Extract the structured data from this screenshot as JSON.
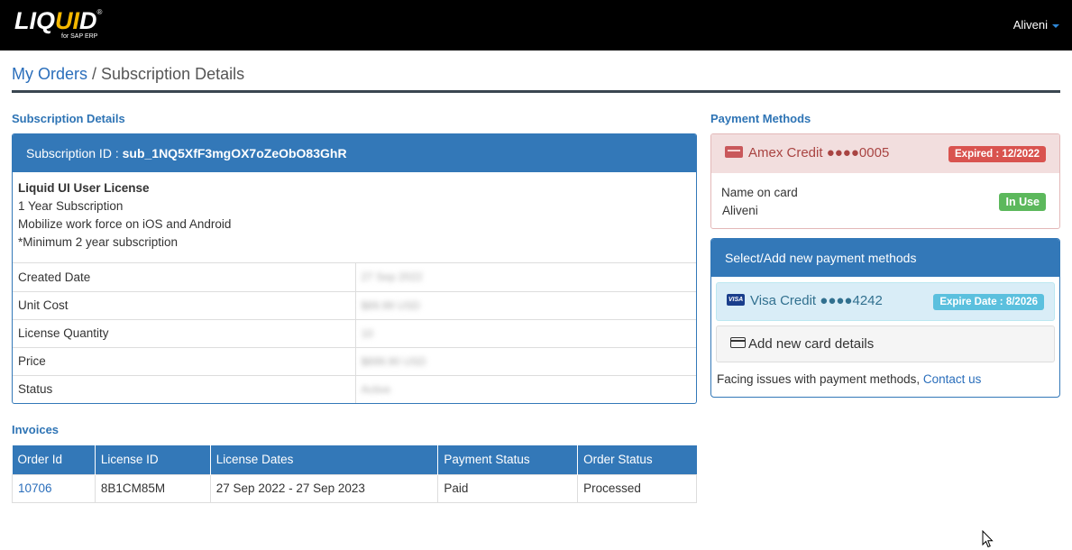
{
  "header": {
    "logo_text_1": "LIQ",
    "logo_text_ui": "UI",
    "logo_text_2": "D",
    "logo_reg": "®",
    "logo_sub": "for SAP ERP",
    "user_name": "Aliveni"
  },
  "breadcrumb": {
    "parent": "My Orders",
    "separator": " / ",
    "current": "Subscription Details"
  },
  "subscription": {
    "section_title": "Subscription Details",
    "id_label": "Subscription ID : ",
    "id_value": "sub_1NQ5XfF3mgOX7oZeObO83GhR",
    "product_name": "Liquid UI User License",
    "line1": "1 Year Subscription",
    "line2": "Mobilize work force on iOS and Android",
    "line3": "*Minimum 2 year subscription",
    "rows": [
      {
        "label": "Created Date",
        "value": "27 Sep 2022"
      },
      {
        "label": "Unit Cost",
        "value": "$89.99 USD"
      },
      {
        "label": "License Quantity",
        "value": "10"
      },
      {
        "label": "Price",
        "value": "$899.90 USD"
      },
      {
        "label": "Status",
        "value": "Active"
      }
    ]
  },
  "invoices": {
    "section_title": "Invoices",
    "columns": [
      "Order Id",
      "License ID",
      "License Dates",
      "Payment Status",
      "Order Status"
    ],
    "rows": [
      {
        "order_id": "10706",
        "license_id": "8B1CM85M",
        "license_dates": "27 Sep 2022 - 27 Sep 2023",
        "payment_status": "Paid",
        "order_status": "Processed"
      }
    ]
  },
  "payment": {
    "section_title": "Payment Methods",
    "current_card": {
      "label": "Amex Credit ●●●●0005",
      "badge": "Expired : 12/2022",
      "name_label": "Name on card",
      "name_value": "Aliveni",
      "status_badge": "In Use",
      "icon": "amex-card-icon"
    },
    "add_panel": {
      "title": "Select/Add new payment methods",
      "visa_label": "Visa Credit ●●●●4242",
      "visa_badge": "Expire Date : 8/2026",
      "visa_icon_text": "VISA",
      "add_label": "Add new card details",
      "facing_text": "Facing issues with payment methods, ",
      "contact_link": "Contact us"
    }
  },
  "colors": {
    "primary": "#3378b8",
    "danger": "#d9534f",
    "success": "#5cb85c",
    "info": "#5bc0de",
    "link": "#2a6ebb"
  }
}
